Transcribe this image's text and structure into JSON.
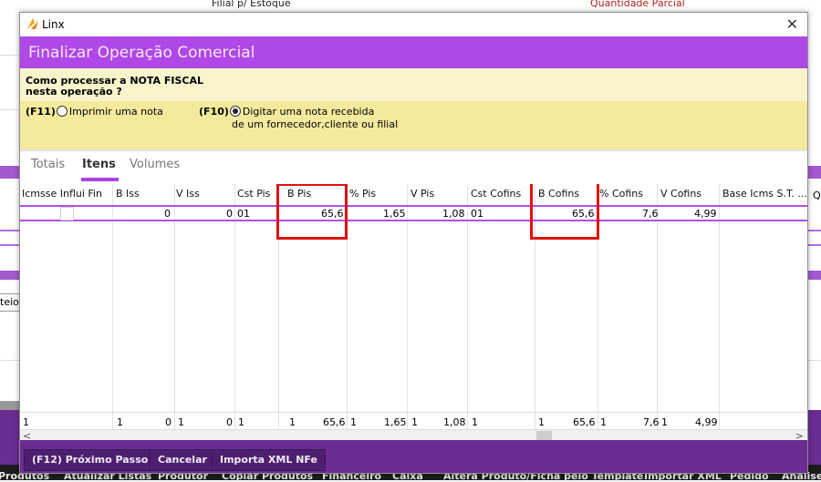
{
  "background": {
    "top_labels": [
      "Filial p/ Estoque",
      "Quantidade Parcial"
    ],
    "side_label": "teio",
    "side_label_right": "Q",
    "taskbar": [
      "Produtos",
      "Atualizar Listas",
      "Produtor",
      "Copiar Produtos",
      "Financeiro",
      "Caixa",
      "Altera Produto/Ficha pelo Template",
      "Importar XML",
      "Pedido",
      "Análise"
    ]
  },
  "window": {
    "app_title": "Linx",
    "close_glyph": "✕"
  },
  "header": {
    "title": "Finalizar Operação Comercial"
  },
  "question": {
    "line1": "Como processar a NOTA FISCAL",
    "line2": "nesta operação ?"
  },
  "options": {
    "print": {
      "key": "(F11)",
      "label": "Imprimir uma nota",
      "selected": false
    },
    "digit": {
      "key": "(F10)",
      "line1": "Digitar uma nota recebida",
      "line2": "de um fornecedor,cliente ou filial",
      "selected": true
    }
  },
  "tabs": [
    {
      "label": "Totais",
      "active": false
    },
    {
      "label": "Itens",
      "active": true
    },
    {
      "label": "Volumes",
      "active": false
    }
  ],
  "grid": {
    "columns": [
      "Icmsse Influi Fin",
      "B Iss",
      "V Iss",
      "Cst Pis",
      "B Pis",
      "% Pis",
      "V Pis",
      "Cst Cofins",
      "B Cofins",
      "% Cofins",
      "V Cofins",
      "Base Icms S.T. ..."
    ],
    "row": {
      "b_iss": "",
      "v_iss": "0",
      "cst_pis_val": "0",
      "cst_pis": "01",
      "b_pis": "65,6",
      "pct_pis": "1,65",
      "v_pis": "1,08",
      "cst_cofins": "01",
      "b_cofins": "65,6",
      "pct_cofins": "7,6",
      "v_cofins": "4,99"
    },
    "totals": [
      "1",
      "1",
      "0",
      "1",
      "0",
      "1",
      "1",
      "65,6",
      "1",
      "1,65",
      "1",
      "1,08",
      "1",
      "1",
      "65,6",
      "1",
      "7,6",
      "1",
      "4,99"
    ],
    "scroll_left": "<",
    "scroll_right": ">"
  },
  "footer": {
    "next": "(F12) Próximo Passo",
    "cancel": "Cancelar",
    "import": "Importa XML NFe"
  },
  "colors": {
    "accent": "#b048e8",
    "highlight_box": "#e01010",
    "footer": "#6b2c94"
  }
}
